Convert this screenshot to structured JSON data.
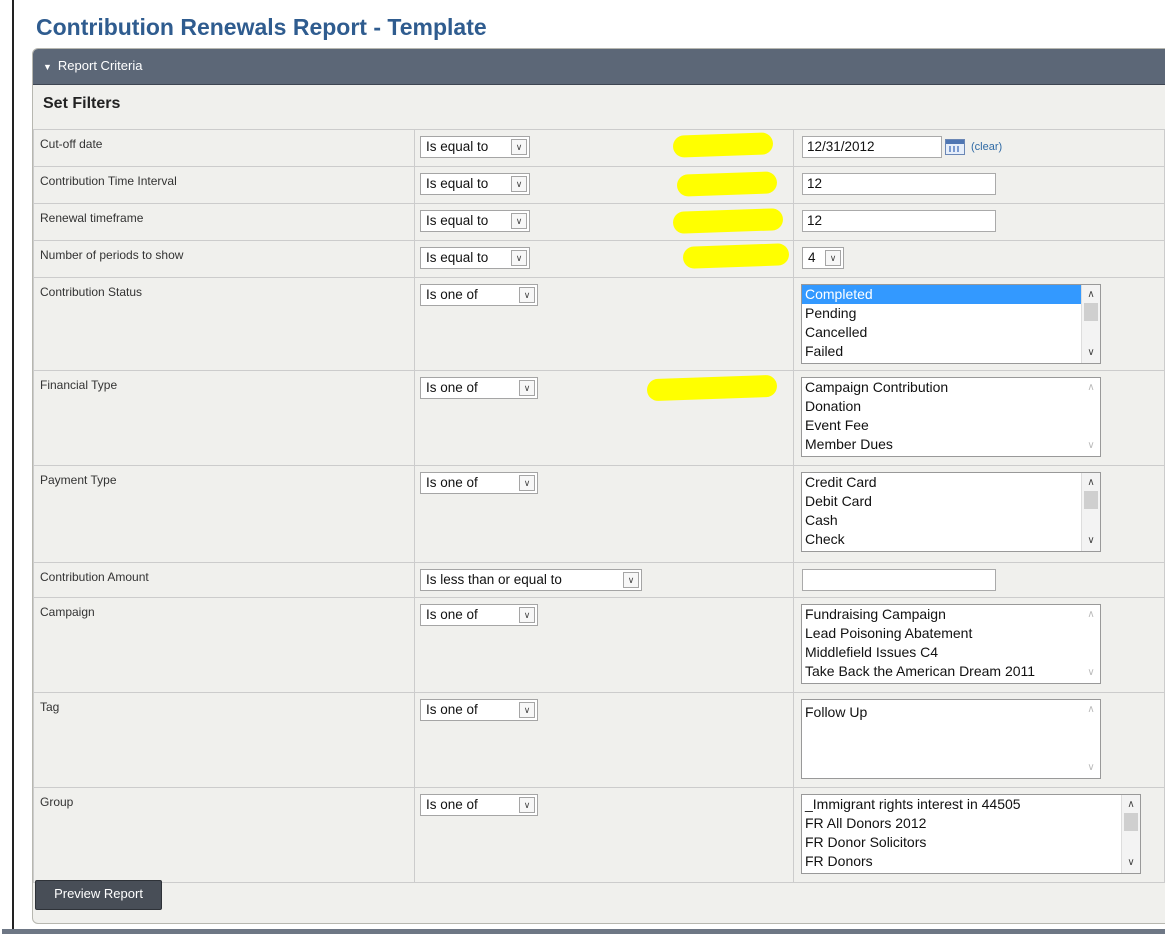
{
  "page": {
    "title": "Contribution Renewals Report - Template"
  },
  "criteria": {
    "header": "Report Criteria",
    "section_title": "Set Filters",
    "clear_link": "(clear)",
    "preview_button": "Preview Report"
  },
  "filters": [
    {
      "label": "Cut-off date",
      "operator": "Is equal to",
      "value": "12/31/2012"
    },
    {
      "label": "Contribution Time Interval",
      "operator": "Is equal to",
      "value": "12"
    },
    {
      "label": "Renewal timeframe",
      "operator": "Is equal to",
      "value": "12"
    },
    {
      "label": "Number of periods to show",
      "operator": "Is equal to",
      "value": "4"
    },
    {
      "label": "Contribution Status",
      "operator": "Is one of",
      "options": [
        "Completed",
        "Pending",
        "Cancelled",
        "Failed"
      ],
      "selected": "Completed"
    },
    {
      "label": "Financial Type",
      "operator": "Is one of",
      "options": [
        "Campaign Contribution",
        "Donation",
        "Event Fee",
        "Member Dues"
      ]
    },
    {
      "label": "Payment Type",
      "operator": "Is one of",
      "options": [
        "Credit Card",
        "Debit Card",
        "Cash",
        "Check"
      ]
    },
    {
      "label": "Contribution Amount",
      "operator": "Is less than or equal to",
      "value": ""
    },
    {
      "label": "Campaign",
      "operator": "Is one of",
      "options": [
        "Fundraising Campaign",
        "Lead Poisoning Abatement",
        "Middlefield Issues C4",
        "Take Back the American Dream 2011"
      ]
    },
    {
      "label": "Tag",
      "operator": "Is one of",
      "options": [
        "Follow Up"
      ]
    },
    {
      "label": "Group",
      "operator": "Is one of",
      "options": [
        "_Immigrant rights interest in 44505",
        "FR All Donors 2012",
        "FR Donor Solicitors",
        "FR Donors"
      ]
    }
  ],
  "colors": {
    "title": "#2f5c8f",
    "header_bar": "#5c6777",
    "highlight": "#ffff00",
    "selected_option": "#3399ff"
  }
}
